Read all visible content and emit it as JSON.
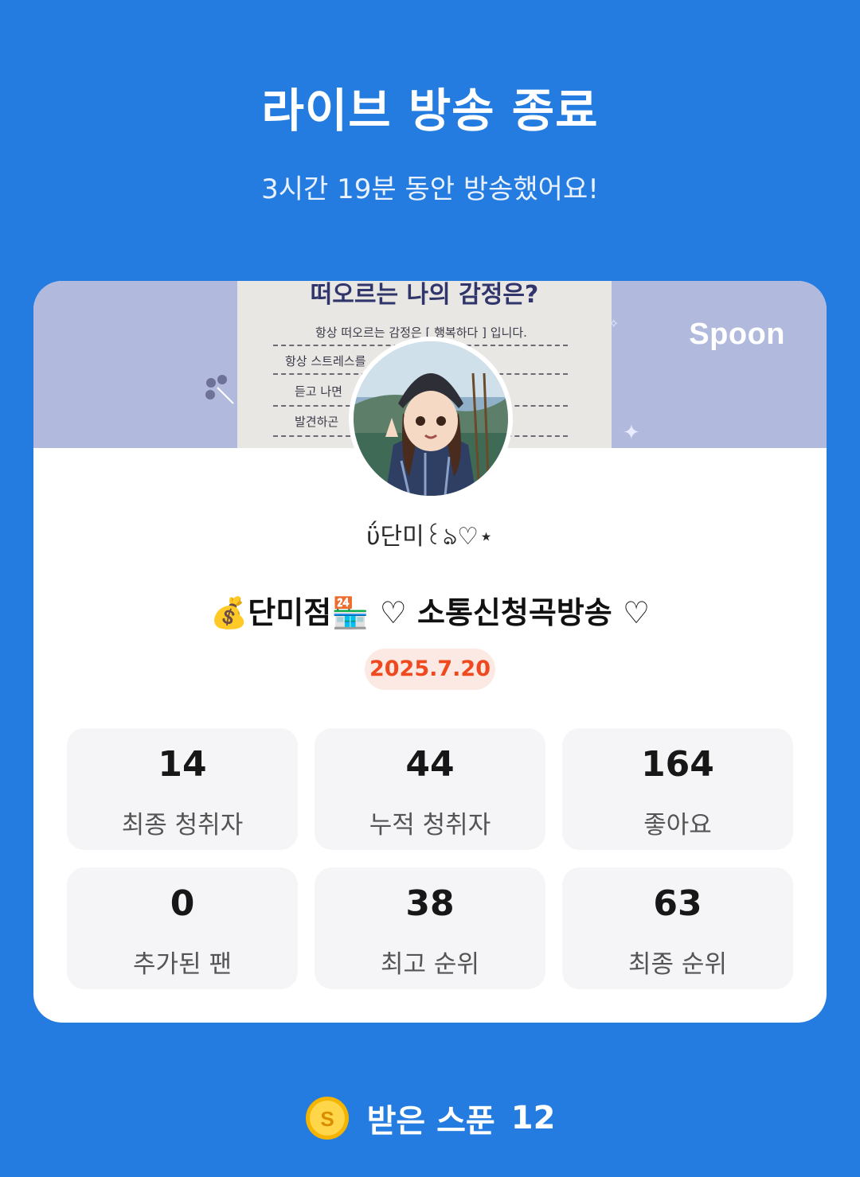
{
  "header": {
    "title": "라이브 방송 종료",
    "subtitle": "3시간 19분 동안 방송했어요!"
  },
  "card": {
    "brand": "Spoon",
    "banner": {
      "heading": "떠오르는 나의 감정은?",
      "lines": [
        "항상 떠오르는 감정은 [ 행복하다 ] 입니다.",
        "항상 스트레스를",
        "듣고 나면",
        "발견하곤"
      ]
    },
    "nickname": "ΰ단미꒰ঌ♡⋆",
    "broadcast_title": "💰단미점🏪 ♡ 소통신청곡방송 ♡",
    "date": "2025.7.20",
    "stats": [
      {
        "value": "14",
        "label": "최종 청취자"
      },
      {
        "value": "44",
        "label": "누적 청취자"
      },
      {
        "value": "164",
        "label": "좋아요"
      },
      {
        "value": "0",
        "label": "추가된 팬"
      },
      {
        "value": "38",
        "label": "최고 순위"
      },
      {
        "value": "63",
        "label": "최종 순위"
      }
    ]
  },
  "footer": {
    "label": "받은 스푼",
    "count": "12",
    "icon": "spoon-coin-icon",
    "coin_letter": "S"
  },
  "colors": {
    "background": "#247ce0",
    "date_text": "#ef4a1f",
    "date_badge": "#fde9e3"
  }
}
